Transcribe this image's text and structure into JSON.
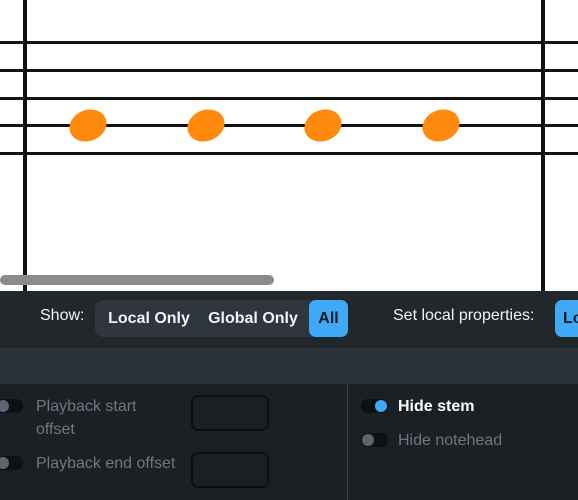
{
  "score": {
    "note_color": "#ff8a0d",
    "note_count": 4
  },
  "show_bar": {
    "show_label": "Show:",
    "filters": [
      {
        "label": "Local Only",
        "active": false
      },
      {
        "label": "Global Only",
        "active": false
      },
      {
        "label": "All",
        "active": true
      }
    ],
    "set_local_label": "Set local properties:",
    "local_button_label": "Lo"
  },
  "properties": {
    "left": [
      {
        "label_line1": "Playback start",
        "label_line2": "offset",
        "enabled": false,
        "value": ""
      },
      {
        "label_line1": "Playback end offset",
        "label_line2": "",
        "enabled": false,
        "value": ""
      }
    ],
    "right": [
      {
        "label": "Hide stem",
        "enabled": true
      },
      {
        "label": "Hide notehead",
        "enabled": false
      }
    ]
  },
  "colors": {
    "accent": "#3fa9f5",
    "panel_bg": "#22272c",
    "props_bg": "#1b2025"
  }
}
